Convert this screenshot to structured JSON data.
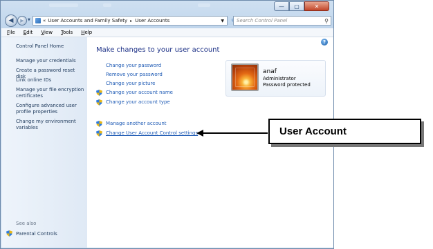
{
  "window": {
    "caption_buttons": {
      "minimize": "—",
      "maximize": "▢",
      "close": "✕"
    }
  },
  "address_bar": {
    "overflow_chevron": "«",
    "crumbs": [
      "User Accounts and Family Safety",
      "User Accounts"
    ],
    "separator": "▸",
    "search_placeholder": "Search Control Panel"
  },
  "menu": [
    {
      "accel": "F",
      "rest": "ile"
    },
    {
      "accel": "E",
      "rest": "dit"
    },
    {
      "accel": "V",
      "rest": "iew"
    },
    {
      "accel": "T",
      "rest": "ools"
    },
    {
      "accel": "H",
      "rest": "elp"
    }
  ],
  "sidebar": {
    "home": "Control Panel Home",
    "links": [
      "Manage your credentials",
      "Create a password reset disk",
      "Link online IDs",
      "Manage your file encryption certificates",
      "Configure advanced user profile properties",
      "Change my environment variables"
    ],
    "see_also": "See also",
    "parental": "Parental Controls"
  },
  "main": {
    "heading": "Make changes to your user account",
    "tasks": [
      "Change your password",
      "Remove your password",
      "Change your picture",
      "Change your account name",
      "Change your account type"
    ],
    "extra_tasks": [
      "Manage another account",
      "Change User Account Control settings"
    ],
    "help": "?"
  },
  "user": {
    "name": "anaf",
    "role": "Administrator",
    "status": "Password protected"
  },
  "annotation": {
    "label": "User Account"
  },
  "icons": [
    "back-arrow-icon",
    "forward-arrow-icon",
    "control-panel-icon",
    "refresh-icon",
    "search-icon",
    "help-icon",
    "shield-icon",
    "parental-controls-icon",
    "user-picture"
  ]
}
